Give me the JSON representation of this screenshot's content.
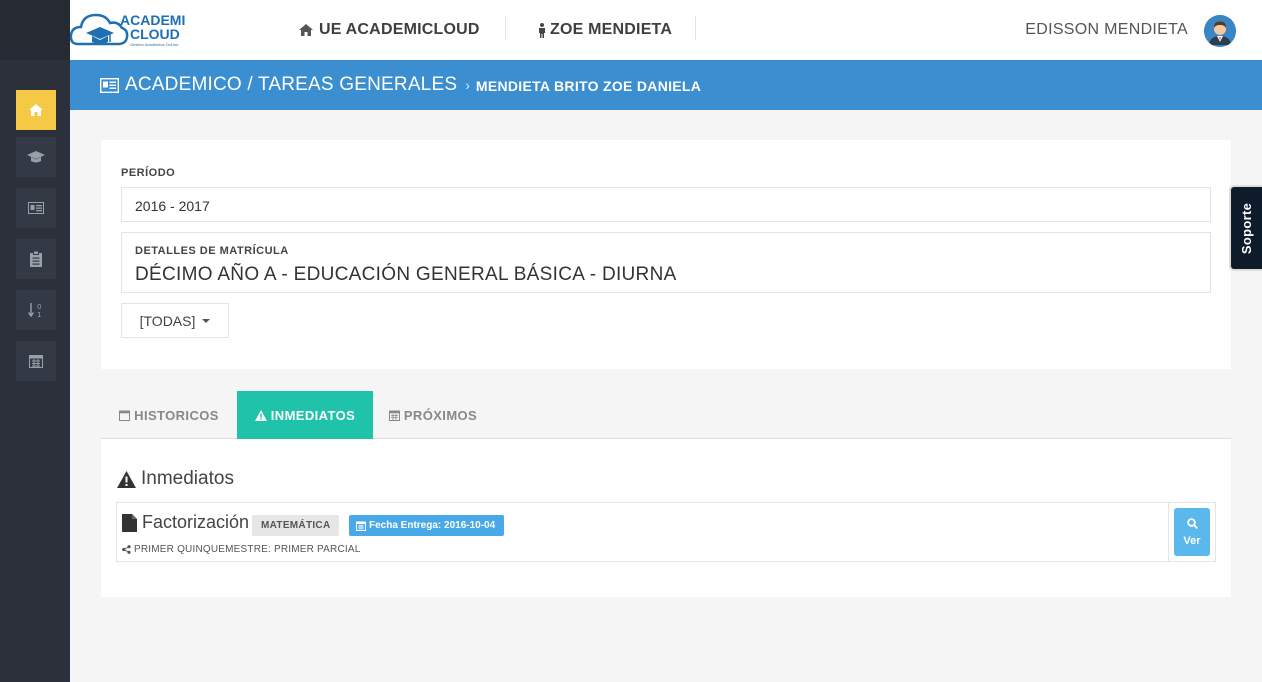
{
  "header": {
    "logo": {
      "line1": "ACADEMI",
      "line2": "CLOUD",
      "tagline": "Gestión Académica OnLine"
    },
    "nav": [
      {
        "label": "UE ACADEMICLOUD",
        "icon": "home-icon"
      },
      {
        "label": "ZOE MENDIETA",
        "icon": "user-icon"
      }
    ],
    "user_name": "EDISSON MENDIETA"
  },
  "sidebar": {
    "items": [
      {
        "icon": "home-icon",
        "active": true
      },
      {
        "icon": "graduation-cap-icon",
        "active": false
      },
      {
        "icon": "id-card-icon",
        "active": false
      },
      {
        "icon": "clipboard-icon",
        "active": false
      },
      {
        "icon": "sort-numeric-icon",
        "active": false
      },
      {
        "icon": "calendar-icon",
        "active": false
      }
    ]
  },
  "breadcrumb": {
    "main": "ACADEMICO / TAREAS GENERALES",
    "separator": "›",
    "sub": "MENDIETA BRITO ZOE DANIELA"
  },
  "filters": {
    "period_label": "PERÍODO",
    "period_value": "2016 - 2017",
    "enrollment_label": "DETALLES DE MATRÍCULA",
    "enrollment_value": "DÉCIMO AÑO A - EDUCACIÓN GENERAL BÁSICA - DIURNA",
    "dropdown_value": "[TODAS]"
  },
  "support_label": "Soporte",
  "tabs": [
    {
      "label": "HISTORICOS",
      "icon": "calendar-outline-icon",
      "active": false
    },
    {
      "label": "INMEDIATOS",
      "icon": "warning-icon",
      "active": true
    },
    {
      "label": "PRÓXIMOS",
      "icon": "calendar-icon",
      "active": false
    }
  ],
  "section": {
    "title": "Inmediatos",
    "tasks": [
      {
        "title": "Factorización",
        "subject": "MATEMÁTICA",
        "due_label": "Fecha Entrega: 2016-10-04",
        "meta": "PRIMER QUINQUEMESTRE: PRIMER PARCIAL",
        "view_label": "Ver"
      }
    ]
  },
  "colors": {
    "sidebar": "#2b303a",
    "active_sidebar": "#f5c845",
    "breadcrumb_bar": "#3b8fd0",
    "active_tab": "#1fc3a9",
    "date_badge": "#49a8e8",
    "view_button": "#5ab8ec"
  }
}
